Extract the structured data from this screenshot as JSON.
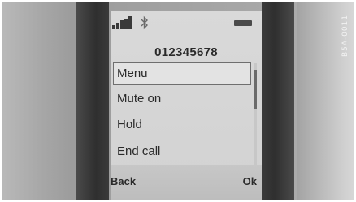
{
  "status": {
    "signal_icon": "signal-strength-icon",
    "bluetooth_icon": "bluetooth-icon",
    "battery_icon": "battery-icon"
  },
  "call": {
    "number": "012345678"
  },
  "menu": {
    "items": [
      {
        "label": "Menu",
        "selected": true
      },
      {
        "label": "Mute on",
        "selected": false
      },
      {
        "label": "Hold",
        "selected": false
      },
      {
        "label": "End call",
        "selected": false
      }
    ]
  },
  "softkeys": {
    "left": "Back",
    "right": "Ok"
  },
  "side_label": "B5A-0011"
}
